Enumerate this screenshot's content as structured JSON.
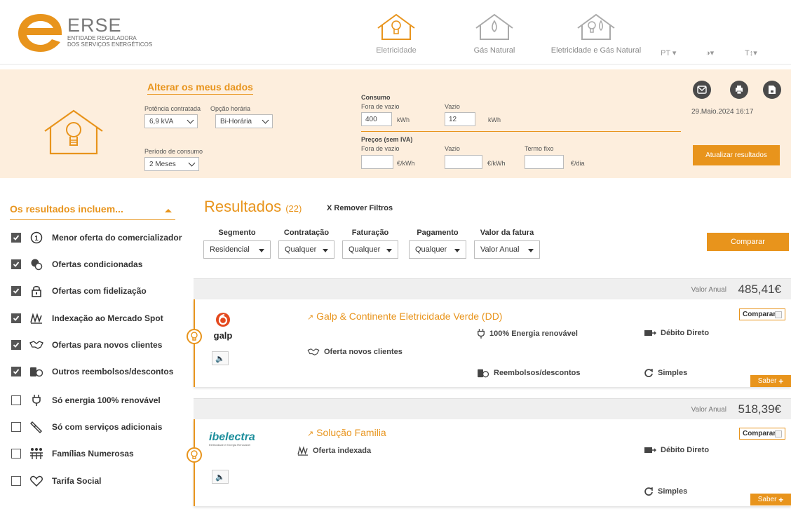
{
  "brand": {
    "name": "ERSE",
    "subtitle_1": "ENTIDADE REGULADORA",
    "subtitle_2": "DOS SERVIÇOS ENERGÉTICOS"
  },
  "nav": {
    "items": [
      {
        "label": "Eletricidade",
        "active": true
      },
      {
        "label": "Gás Natural",
        "active": false
      },
      {
        "label": "Eletricidade e Gás Natural",
        "active": false
      }
    ],
    "language": "PT",
    "contrast": "◑",
    "textsize": "T↕"
  },
  "panel": {
    "title": "Alterar os meus dados",
    "potencia_label": "Potência contratada",
    "potencia_value": "6,9 kVA",
    "opcao_label": "Opção horária",
    "opcao_value": "Bi-Horária",
    "periodo_label": "Período de consumo",
    "periodo_value": "2 Meses",
    "consumo_heading": "Consumo",
    "fora_vazio_label": "Fora de vazio",
    "fora_vazio_value": "400",
    "vazio_label": "Vazio",
    "vazio_value": "12",
    "unit_kwh": "kWh",
    "precos_heading": "Preços (sem IVA)",
    "preco_fora_vazio_label": "Fora de vazio",
    "preco_vazio_label": "Vazio",
    "termo_fixo_label": "Termo fixo",
    "unit_eur_kwh": "€/kWh",
    "unit_eur_dia": "€/dia",
    "date": "29.Maio.2024 16:17",
    "update_label": "Atualizar resultados"
  },
  "sidebar": {
    "title": "Os resultados incluem...",
    "items": [
      {
        "label": "Menor oferta do comercializador",
        "checked": true,
        "icon": "number-one-icon"
      },
      {
        "label": "Ofertas condicionadas",
        "checked": true,
        "icon": "coins-icon"
      },
      {
        "label": "Ofertas com fidelização",
        "checked": true,
        "icon": "lock-icon"
      },
      {
        "label": "Indexação ao Mercado Spot",
        "checked": true,
        "icon": "spot-chart-icon"
      },
      {
        "label": "Ofertas para novos clientes",
        "checked": true,
        "icon": "handshake-icon"
      },
      {
        "label": "Outros reembolsos/descontos",
        "checked": true,
        "icon": "refund-icon"
      },
      {
        "label": "Só energia 100% renovável",
        "checked": false,
        "icon": "plug-icon"
      },
      {
        "label": "Só com serviços adicionais",
        "checked": false,
        "icon": "tools-icon"
      },
      {
        "label": "Famílias Numerosas",
        "checked": false,
        "icon": "family-icon"
      },
      {
        "label": "Tarifa Social",
        "checked": false,
        "icon": "heart-icon"
      }
    ]
  },
  "results": {
    "title": "Resultados",
    "count": "(22)",
    "remove_filters": "X Remover Filtros",
    "compare_label": "Comparar",
    "filters": [
      {
        "label": "Segmento",
        "value": "Residencial"
      },
      {
        "label": "Contratação",
        "value": "Qualquer"
      },
      {
        "label": "Faturação",
        "value": "Qualquer"
      },
      {
        "label": "Pagamento",
        "value": "Qualquer"
      },
      {
        "label": "Valor da fatura",
        "value": "Valor Anual"
      }
    ]
  },
  "offers": [
    {
      "value_label": "Valor Anual",
      "value": "485,41€",
      "name": "Galp & Continente Eletricidade Verde (DD)",
      "logo_text": "galp",
      "renewable": "100% Energia renovável",
      "payment": "Débito Direto",
      "new_clients": "Oferta novos clientes",
      "refund": "Reembolsos/descontos",
      "billing": "Simples",
      "compare_label": "Comparar",
      "saber_label": "Saber"
    },
    {
      "value_label": "Valor Anual",
      "value": "518,39€",
      "name": "Solução Familia",
      "logo_text": "ibelectra",
      "logo_sub": "Eletricidade e Energia Renovável",
      "indexed": "Oferta indexada",
      "payment": "Débito Direto",
      "billing": "Simples",
      "compare_label": "Comparar",
      "saber_label": "Saber"
    }
  ],
  "colors": {
    "accent": "#e8941c",
    "panel_bg": "#fdeedd",
    "dark_btn": "#4a4a4a"
  }
}
